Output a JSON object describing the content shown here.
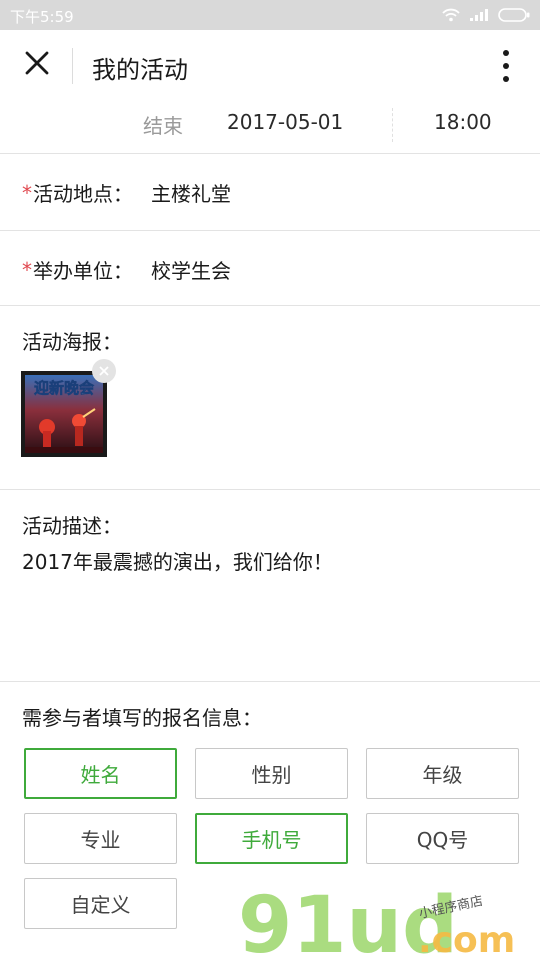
{
  "status_bar": {
    "time": "下午5:59"
  },
  "header": {
    "title": "我的活动"
  },
  "end": {
    "label": "结束",
    "date": "2017-05-01",
    "time": "18:00"
  },
  "location": {
    "label": "活动地点：",
    "value": "主楼礼堂"
  },
  "organizer": {
    "label": "举办单位：",
    "value": "校学生会"
  },
  "poster": {
    "label": "活动海报：",
    "text": "迎新晚会"
  },
  "description": {
    "label": "活动描述：",
    "text": "2017年最震撼的演出，我们给你！"
  },
  "signup": {
    "label": "需参与者填写的报名信息：",
    "fields": [
      {
        "label": "姓名",
        "selected": true
      },
      {
        "label": "性别",
        "selected": false
      },
      {
        "label": "年级",
        "selected": false
      },
      {
        "label": "专业",
        "selected": false
      },
      {
        "label": "手机号",
        "selected": true
      },
      {
        "label": "QQ号",
        "selected": false
      },
      {
        "label": "自定义",
        "selected": false
      }
    ]
  },
  "watermark": {
    "brand": "91ud",
    "domain": ".com",
    "tagline": "小程序商店"
  },
  "colors": {
    "accent": "#3faa3b",
    "required": "#e0484f",
    "status_bar": "#d9d9d9"
  }
}
